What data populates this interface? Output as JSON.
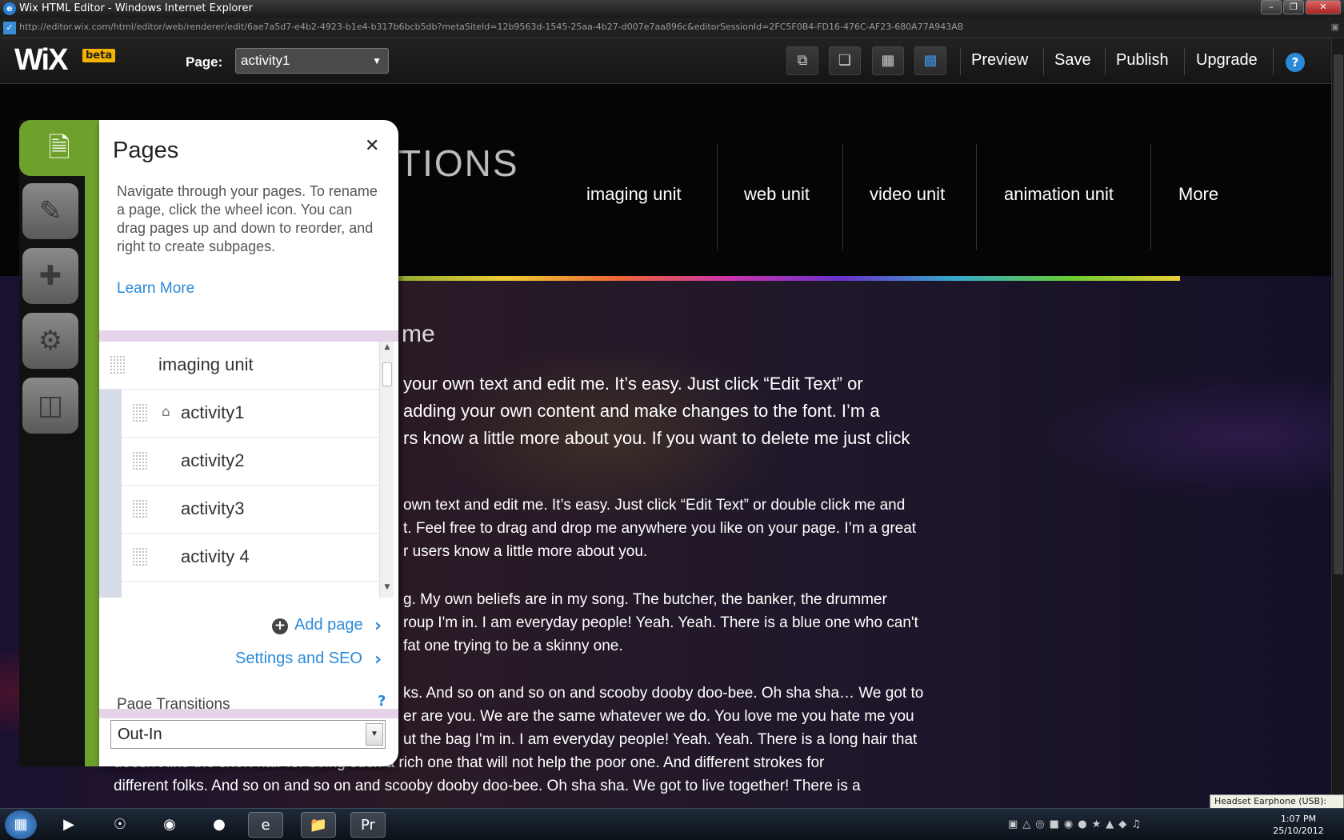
{
  "browser": {
    "title": "Wix HTML Editor - Windows Internet Explorer",
    "url": "http://editor.wix.com/html/editor/web/renderer/edit/6ae7a5d7-e4b2-4923-b1e4-b317b6bcb5db?metaSiteId=12b9563d-1545-25aa-4b27-d007e7aa896c&editorSessionId=2FC5F0B4-FD16-476C-AF23-680A77A943AB"
  },
  "editor": {
    "logo": "WiX",
    "badge": "beta",
    "page_label": "Page:",
    "page_value": "activity1",
    "nav": [
      "Preview",
      "Save",
      "Publish",
      "Upgrade"
    ],
    "help": "?"
  },
  "site": {
    "brand": "TIONS",
    "nav": [
      "imaging unit",
      "web unit",
      "video unit",
      "animation unit",
      "More"
    ],
    "heading": "me",
    "lines_big": [
      "your own text and edit me. It’s easy. Just click “Edit Text” or",
      "adding your own content and make changes to the font. I’m a",
      "rs know a little more about you. If you want to delete me just click"
    ],
    "lines_p2": [
      "own text and edit me. It’s easy. Just click “Edit Text” or double click me and",
      "t. Feel free to drag and drop me anywhere you like on your page. I’m a great",
      "r users know a little more about you."
    ],
    "lines_p3": [
      "g. My own beliefs are in my song. The butcher, the banker, the drummer",
      "roup I'm in. I am everyday people! Yeah. Yeah. There is a blue one who can't",
      "fat one trying to be a skinny one."
    ],
    "lines_p4": [
      "ks. And so on and so on and scooby dooby doo-bee. Oh sha sha… We got to",
      "er are you. We are the same whatever we do. You love me you hate me you",
      "ut the bag I'm in. I am everyday people! Yeah. Yeah. There is a long hair that",
      "doesn't like the short hair for being such a rich one that will not help the poor one. And different strokes for",
      "different folks. And so on and so on and scooby dooby doo-bee. Oh sha sha. We got to live together! There is a"
    ]
  },
  "pages_panel": {
    "title": "Pages",
    "description": "Navigate through your pages. To rename a page, click the wheel icon. You can drag pages up and down to reorder, and right to create subpages.",
    "learn_more": "Learn More",
    "parent": "imaging unit",
    "children": [
      "activity1",
      "activity2",
      "activity3",
      "activity 4"
    ],
    "add_page": "Add page",
    "settings_seo": "Settings and SEO",
    "transitions_label": "Page Transitions",
    "transitions_help": "?",
    "transition_value": "Out-In"
  },
  "system": {
    "time": "1:07 PM",
    "date": "25/10/2012",
    "tooltip": "Headset Earphone (USB): 90%"
  },
  "colors": {
    "accent_green": "#6ea12c",
    "link_blue": "#2a8ad8"
  },
  "icons": {
    "strip": [
      "pages-icon",
      "design-brush-icon",
      "add-icon",
      "settings-gear-icon",
      "app-market-icon"
    ]
  }
}
